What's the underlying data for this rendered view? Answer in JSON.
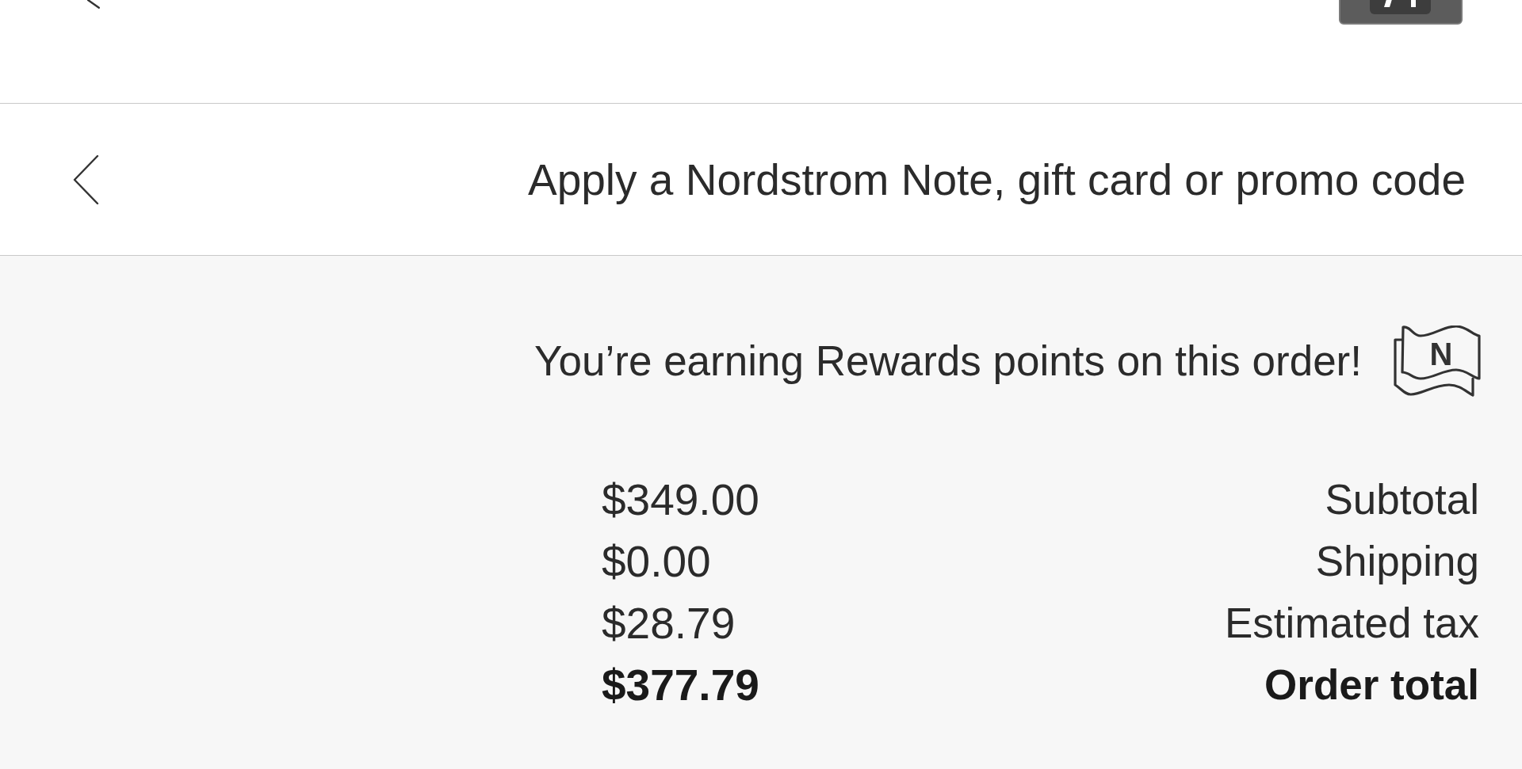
{
  "promo_row": {
    "label": "Apply a Nordstrom Note, gift card or promo code"
  },
  "rewards": {
    "logo_letter": "N",
    "message": "You’re earning Rewards points on this order!"
  },
  "totals": [
    {
      "kind": "line",
      "label": "Subtotal",
      "amount": "$349.00"
    },
    {
      "kind": "line",
      "label": "Shipping",
      "amount": "$0.00"
    },
    {
      "kind": "line",
      "label": "Estimated tax",
      "amount": "$28.79"
    },
    {
      "kind": "total",
      "label": "Order total",
      "amount": "$377.79"
    }
  ]
}
